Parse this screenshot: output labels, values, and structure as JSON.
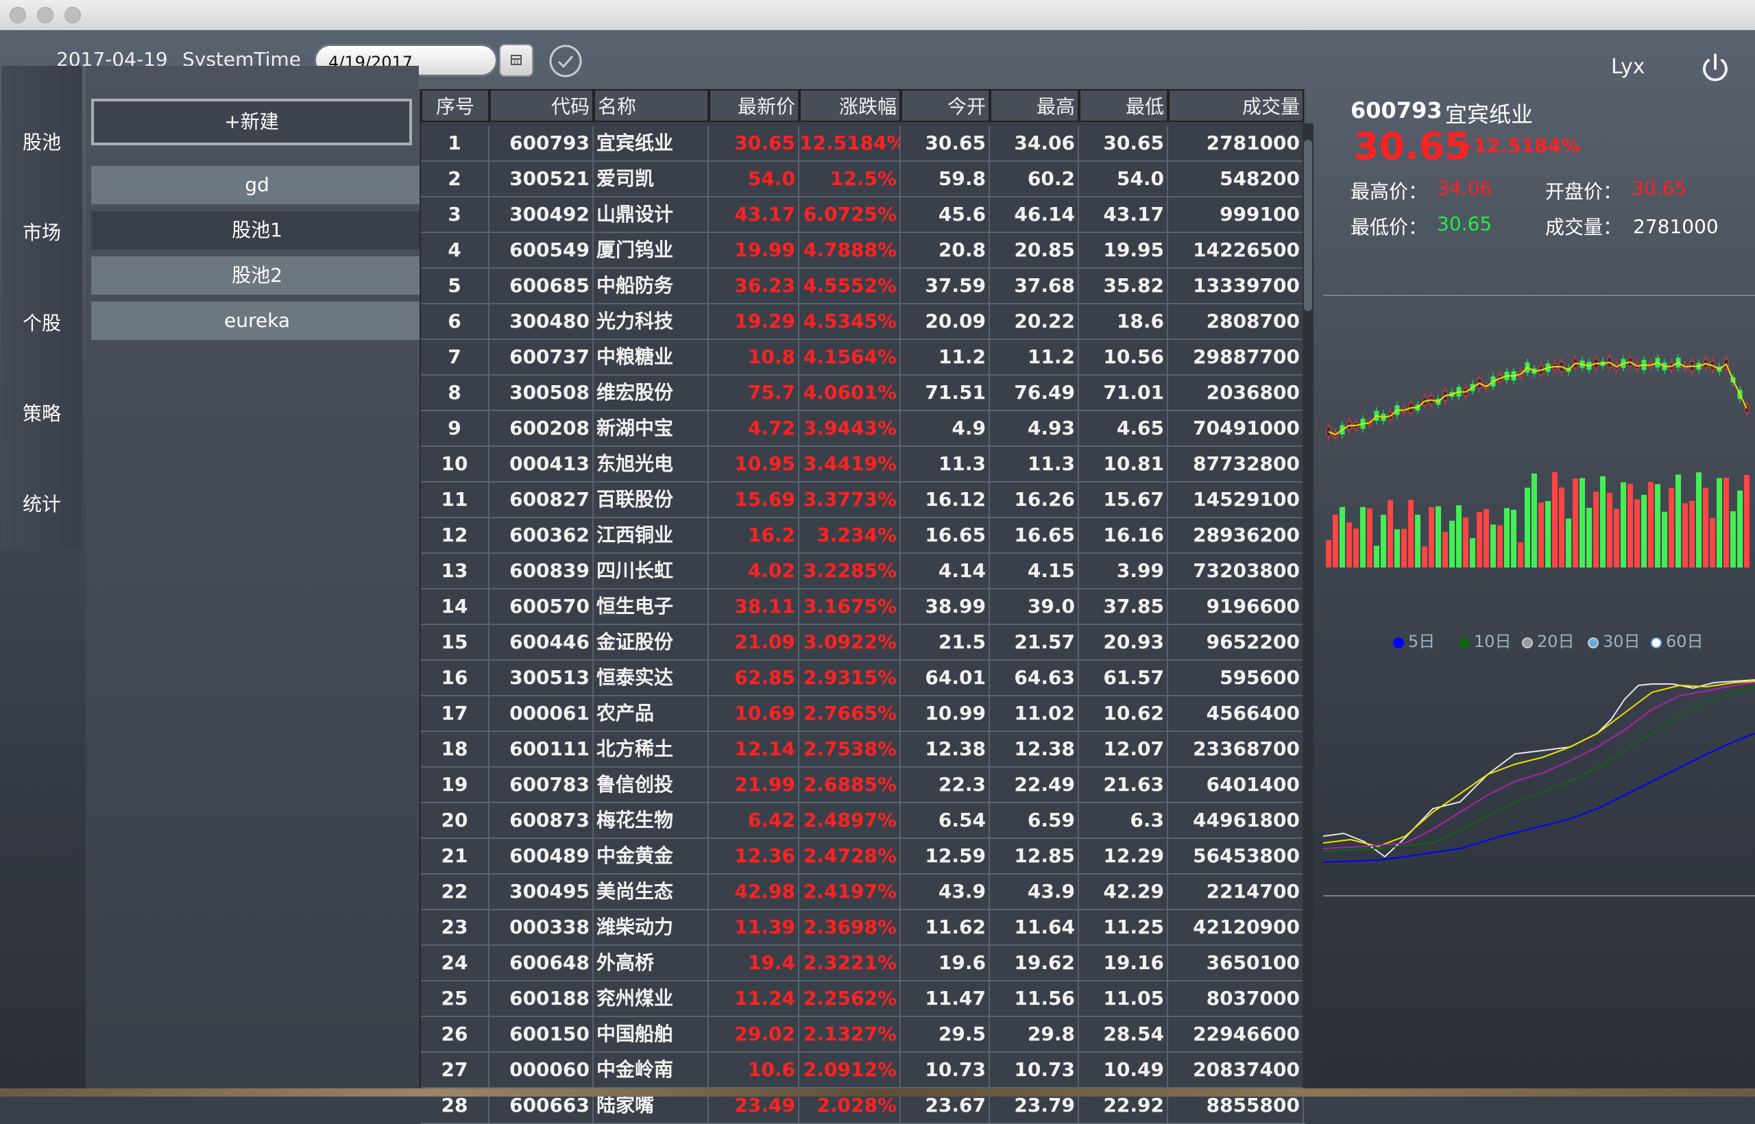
{
  "topbar": {
    "date": "2017-04-19",
    "system_time_label": "SystemTime",
    "date_input_value": "4/19/2017",
    "user": "Lyx"
  },
  "nav": [
    "股池",
    "市场",
    "个股",
    "策略",
    "统计"
  ],
  "pools": {
    "new_button": "+新建",
    "items": [
      "gd",
      "股池1",
      "股池2",
      "eureka"
    ]
  },
  "table": {
    "headers": [
      "序号",
      "代码",
      "名称",
      "最新价",
      "涨跌幅",
      "今开",
      "最高",
      "最低",
      "成交量"
    ],
    "rows": [
      [
        "1",
        "600793",
        "宜宾纸业",
        "30.65",
        "12.5184%",
        "30.65",
        "34.06",
        "30.65",
        "2781000"
      ],
      [
        "2",
        "300521",
        "爱司凯",
        "54.0",
        "12.5%",
        "59.8",
        "60.2",
        "54.0",
        "548200"
      ],
      [
        "3",
        "300492",
        "山鼎设计",
        "43.17",
        "6.0725%",
        "45.6",
        "46.14",
        "43.17",
        "999100"
      ],
      [
        "4",
        "600549",
        "厦门钨业",
        "19.99",
        "4.7888%",
        "20.8",
        "20.85",
        "19.95",
        "14226500"
      ],
      [
        "5",
        "600685",
        "中船防务",
        "36.23",
        "4.5552%",
        "37.59",
        "37.68",
        "35.82",
        "13339700"
      ],
      [
        "6",
        "300480",
        "光力科技",
        "19.29",
        "4.5345%",
        "20.09",
        "20.22",
        "18.6",
        "2808700"
      ],
      [
        "7",
        "600737",
        "中粮糖业",
        "10.8",
        "4.1564%",
        "11.2",
        "11.2",
        "10.56",
        "29887700"
      ],
      [
        "8",
        "300508",
        "维宏股份",
        "75.7",
        "4.0601%",
        "71.51",
        "76.49",
        "71.01",
        "2036800"
      ],
      [
        "9",
        "600208",
        "新湖中宝",
        "4.72",
        "3.9443%",
        "4.9",
        "4.93",
        "4.65",
        "70491000"
      ],
      [
        "10",
        "000413",
        "东旭光电",
        "10.95",
        "3.4419%",
        "11.3",
        "11.3",
        "10.81",
        "87732800"
      ],
      [
        "11",
        "600827",
        "百联股份",
        "15.69",
        "3.3773%",
        "16.12",
        "16.26",
        "15.67",
        "14529100"
      ],
      [
        "12",
        "600362",
        "江西铜业",
        "16.2",
        "3.234%",
        "16.65",
        "16.65",
        "16.16",
        "28936200"
      ],
      [
        "13",
        "600839",
        "四川长虹",
        "4.02",
        "3.2285%",
        "4.14",
        "4.15",
        "3.99",
        "73203800"
      ],
      [
        "14",
        "600570",
        "恒生电子",
        "38.11",
        "3.1675%",
        "38.99",
        "39.0",
        "37.85",
        "9196600"
      ],
      [
        "15",
        "600446",
        "金证股份",
        "21.09",
        "3.0922%",
        "21.5",
        "21.57",
        "20.93",
        "9652200"
      ],
      [
        "16",
        "300513",
        "恒泰实达",
        "62.85",
        "2.9315%",
        "64.01",
        "64.63",
        "61.57",
        "595600"
      ],
      [
        "17",
        "000061",
        "农产品",
        "10.69",
        "2.7665%",
        "10.99",
        "11.02",
        "10.62",
        "4566400"
      ],
      [
        "18",
        "600111",
        "北方稀土",
        "12.14",
        "2.7538%",
        "12.38",
        "12.38",
        "12.07",
        "23368700"
      ],
      [
        "19",
        "600783",
        "鲁信创投",
        "21.99",
        "2.6885%",
        "22.3",
        "22.49",
        "21.63",
        "6401400"
      ],
      [
        "20",
        "600873",
        "梅花生物",
        "6.42",
        "2.4897%",
        "6.54",
        "6.59",
        "6.3",
        "44961800"
      ],
      [
        "21",
        "600489",
        "中金黄金",
        "12.36",
        "2.4728%",
        "12.59",
        "12.85",
        "12.29",
        "56453800"
      ],
      [
        "22",
        "300495",
        "美尚生态",
        "42.98",
        "2.4197%",
        "43.9",
        "43.9",
        "42.29",
        "2214700"
      ],
      [
        "23",
        "000338",
        "潍柴动力",
        "11.39",
        "2.3698%",
        "11.62",
        "11.64",
        "11.25",
        "42120900"
      ],
      [
        "24",
        "600648",
        "外高桥",
        "19.4",
        "2.3221%",
        "19.6",
        "19.62",
        "19.16",
        "3650100"
      ],
      [
        "25",
        "600188",
        "兖州煤业",
        "11.24",
        "2.2562%",
        "11.47",
        "11.56",
        "11.05",
        "8037000"
      ],
      [
        "26",
        "600150",
        "中国船舶",
        "29.02",
        "2.1327%",
        "29.5",
        "29.8",
        "28.54",
        "22946600"
      ],
      [
        "27",
        "000060",
        "中金岭南",
        "10.6",
        "2.0912%",
        "10.73",
        "10.73",
        "10.49",
        "20837400"
      ],
      [
        "28",
        "600663",
        "陆家嘴",
        "23.49",
        "2.028%",
        "23.67",
        "23.79",
        "22.92",
        "8855800"
      ]
    ]
  },
  "detail": {
    "code": "600793",
    "name": "宜宾纸业",
    "price": "30.65",
    "change": "+12.5184%",
    "high_label": "最高价：",
    "high": "34.06",
    "open_label": "开盘价：",
    "open": "30.65",
    "low_label": "最低价：",
    "low": "30.65",
    "volume_label": "成交量：",
    "volume": "2781000"
  },
  "ma_legend": [
    "5日",
    "10日",
    "20日",
    "30日",
    "60日"
  ],
  "colors": {
    "up": "#ff2222",
    "down": "#22dd44",
    "ma5": "#0000ff",
    "ma10": "#116611",
    "ma20": "#9a9a9a",
    "ma30": "#66aadd",
    "ma60": "#ffffff"
  }
}
